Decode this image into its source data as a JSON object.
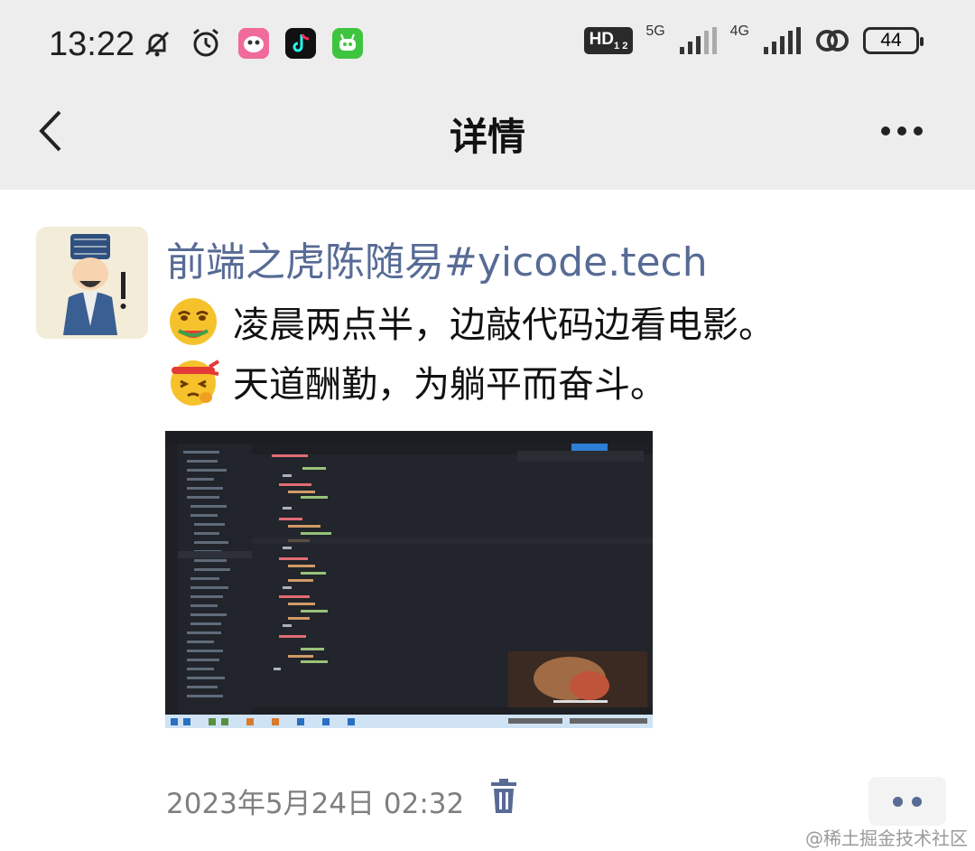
{
  "status_bar": {
    "time": "13:22",
    "icons": [
      "mute-bell-icon",
      "alarm-clock-icon",
      "app-icon-pink",
      "tiktok-icon",
      "app-icon-green"
    ],
    "hd_badge": "HD",
    "hd_sub": "1 2",
    "network_5g": "5G",
    "network_4g": "4G",
    "battery": "44"
  },
  "nav": {
    "title": "详情",
    "back_icon": "chevron-left-icon",
    "more_icon": "more-horizontal-icon"
  },
  "post": {
    "author": "前端之虎陈随易#yicode.tech",
    "line1": "凌晨两点半，边敲代码边看电影。",
    "line2": "天道酬勤，为躺平而奋斗。",
    "timestamp": "2023年5月24日 02:32"
  },
  "watermark": "@稀土掘金技术社区",
  "colors": {
    "link": "#576b95",
    "topbar_bg": "#ededed",
    "screenshot_bg": "#22252b"
  }
}
